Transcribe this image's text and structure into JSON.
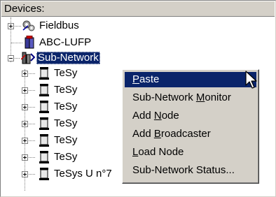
{
  "panel": {
    "header": "Devices:"
  },
  "tree": {
    "items": [
      {
        "label": "Fieldbus",
        "icon": "fieldbus-gear-icon",
        "expander": "plus"
      },
      {
        "label": "ABC-LUFP",
        "icon": "gateway-device-icon",
        "expander": "none"
      },
      {
        "label": "Sub-Network",
        "icon": "sub-network-icon",
        "expander": "minus",
        "selected": true
      }
    ],
    "children": [
      {
        "label": "TeSy",
        "icon": "tesys-node-icon"
      },
      {
        "label": "TeSy",
        "icon": "tesys-node-icon"
      },
      {
        "label": "TeSy",
        "icon": "tesys-node-icon"
      },
      {
        "label": "TeSy",
        "icon": "tesys-node-icon"
      },
      {
        "label": "TeSy",
        "icon": "tesys-node-icon"
      },
      {
        "label": "TeSy",
        "icon": "tesys-node-icon"
      },
      {
        "label": "TeSys U n°7",
        "icon": "tesys-node-icon"
      }
    ]
  },
  "context_menu": {
    "items": [
      {
        "pre": "",
        "key": "P",
        "post": "aste",
        "highlighted": true
      },
      {
        "pre": "Sub-Network ",
        "key": "M",
        "post": "onitor",
        "highlighted": false
      },
      {
        "pre": "Add ",
        "key": "N",
        "post": "ode",
        "highlighted": false
      },
      {
        "pre": "Add ",
        "key": "B",
        "post": "roadcaster",
        "highlighted": false
      },
      {
        "pre": "",
        "key": "L",
        "post": "oad Node",
        "highlighted": false
      },
      {
        "pre": "Sub-Network Status...",
        "key": "",
        "post": "",
        "highlighted": false
      }
    ]
  },
  "colors": {
    "selection": "#0a246a",
    "menu_bg": "#d4d0c8"
  }
}
